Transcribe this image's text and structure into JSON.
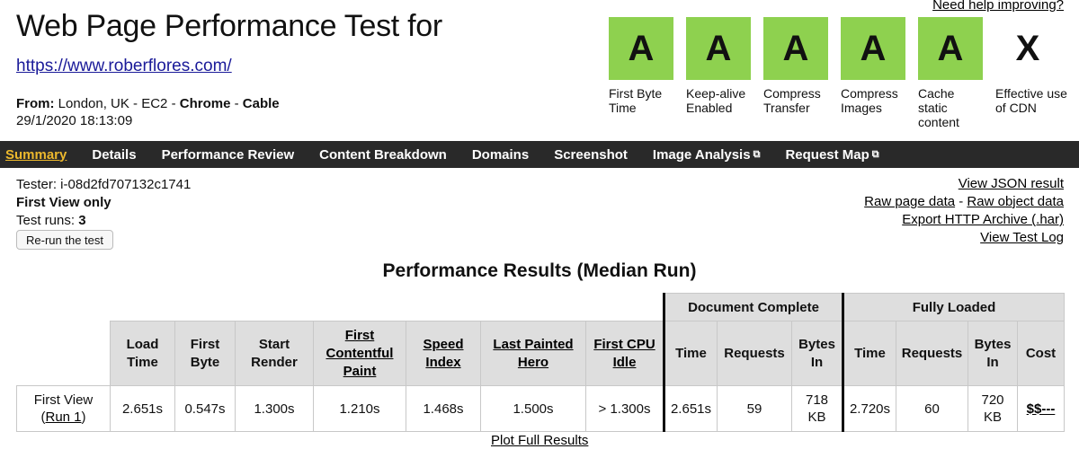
{
  "header": {
    "help_link": "Need help improving?",
    "title": "Web Page Performance Test for",
    "url": "https://www.roberflores.com/",
    "from_label": "From:",
    "location": " London, UK - EC2 - ",
    "browser": "Chrome",
    "separator": " - ",
    "connection": "Cable",
    "date": "29/1/2020 18:13:09"
  },
  "grades": [
    {
      "grade": "A",
      "label": "First Byte Time"
    },
    {
      "grade": "A",
      "label": "Keep-alive Enabled"
    },
    {
      "grade": "A",
      "label": "Compress Transfer"
    },
    {
      "grade": "A",
      "label": "Compress Images"
    },
    {
      "grade": "A",
      "label": "Cache static content"
    },
    {
      "grade": "X",
      "label": "Effective use of CDN"
    }
  ],
  "colors": {
    "grade_good": "#8ed14f",
    "nav_bg": "#292929",
    "nav_active": "#ecb82d"
  },
  "nav": {
    "summary": "Summary",
    "details": "Details",
    "performance_review": "Performance Review",
    "content_breakdown": "Content Breakdown",
    "domains": "Domains",
    "screenshot": "Screenshot",
    "image_analysis": "Image Analysis",
    "request_map": "Request Map",
    "external_icon": "external-link-icon"
  },
  "info": {
    "tester": "Tester: i-08d2fd707132c1741",
    "view_mode": "First View only",
    "test_runs_label": "Test runs: ",
    "test_runs": "3",
    "rerun": "Re-run the test"
  },
  "links": {
    "json": "View JSON result",
    "raw_page": "Raw page data",
    "dash": " - ",
    "raw_object": "Raw object data",
    "har": "Export HTTP Archive (.har)",
    "log": "View Test Log"
  },
  "results": {
    "title": "Performance Results (Median Run)",
    "group_doc": "Document Complete",
    "group_full": "Fully Loaded",
    "cols": {
      "load_time": "Load Time",
      "first_byte": "First Byte",
      "start_render": "Start Render",
      "fcp": "First Contentful Paint",
      "speed_index": "Speed Index",
      "lph": "Last Painted Hero",
      "cpu_idle": "First CPU Idle",
      "doc_time": "Time",
      "doc_requests": "Requests",
      "doc_bytes": "Bytes In",
      "full_time": "Time",
      "full_requests": "Requests",
      "full_bytes": "Bytes In",
      "cost": "Cost"
    },
    "row": {
      "label": "First View",
      "run_open": "(",
      "run_link": "Run 1",
      "run_close": ")",
      "load_time": "2.651s",
      "first_byte": "0.547s",
      "start_render": "1.300s",
      "fcp": "1.210s",
      "speed_index": "1.468s",
      "lph": "1.500s",
      "cpu_idle": "> 1.300s",
      "doc_time": "2.651s",
      "doc_requests": "59",
      "doc_bytes_num": "718",
      "doc_bytes_unit": "KB",
      "full_time": "2.720s",
      "full_requests": "60",
      "full_bytes_num": "720",
      "full_bytes_unit": "KB",
      "cost": "$$---"
    },
    "plot_link": "Plot Full Results"
  }
}
